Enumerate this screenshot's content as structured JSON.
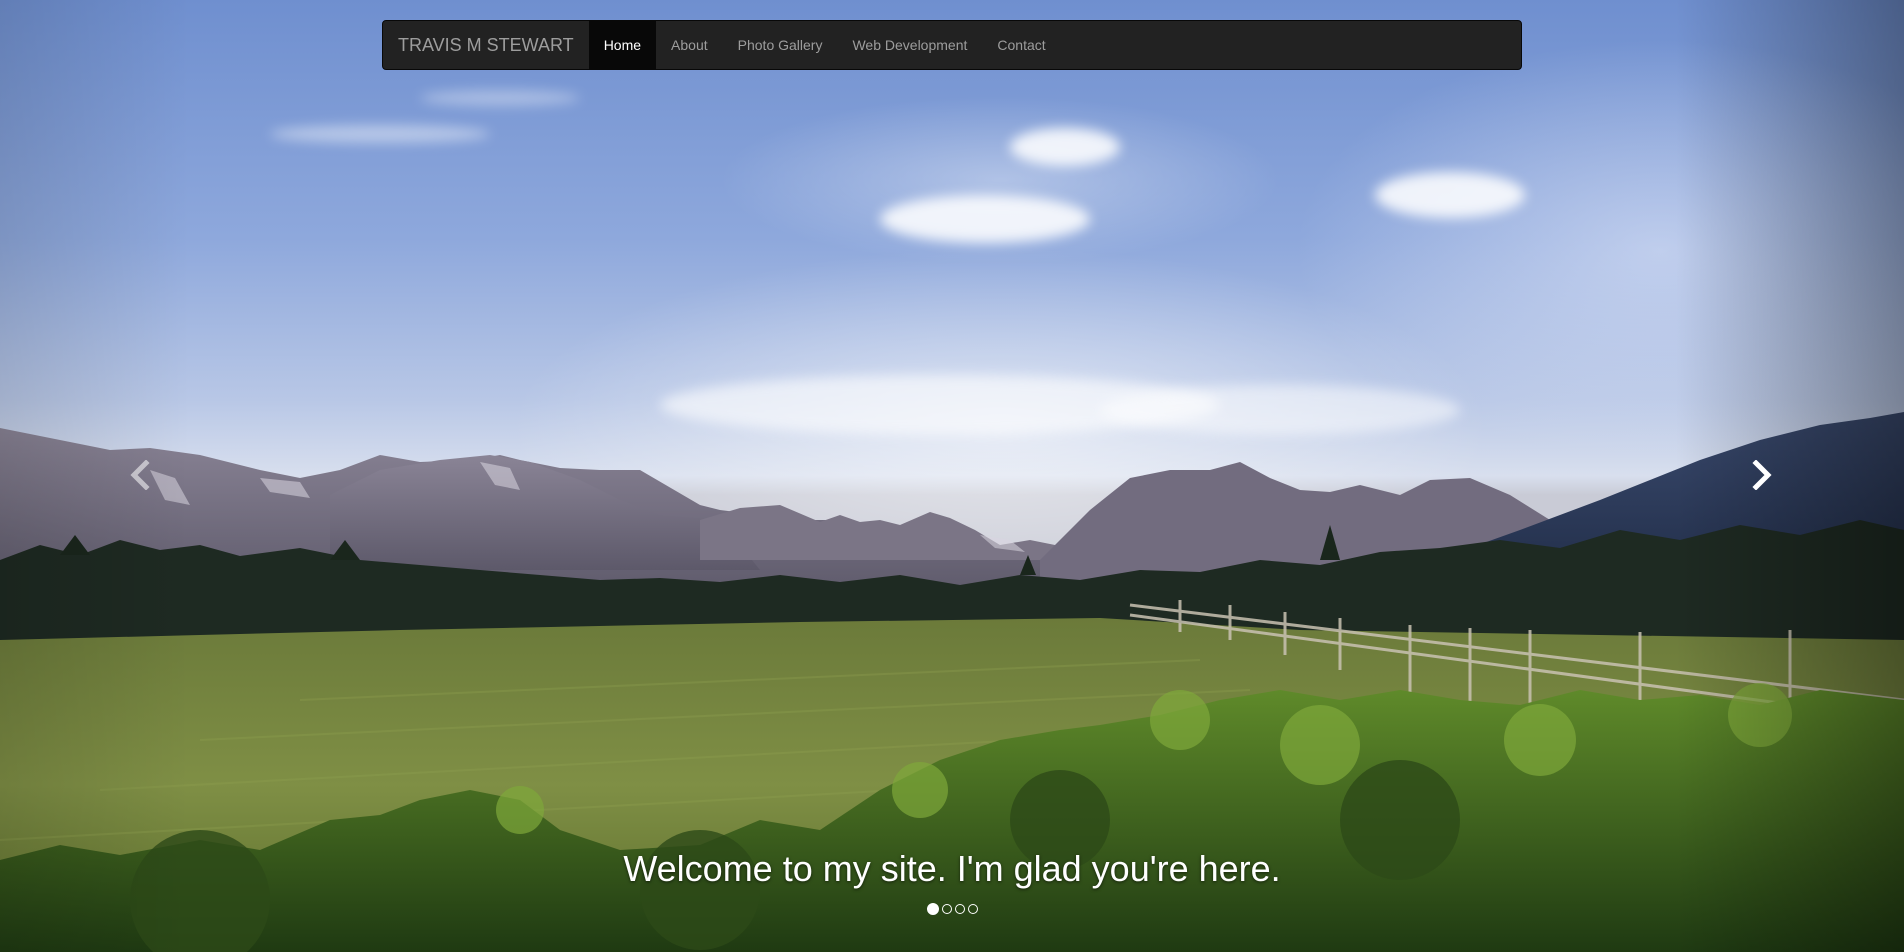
{
  "navbar": {
    "brand": "TRAVIS M STEWART",
    "items": [
      {
        "label": "Home",
        "active": true
      },
      {
        "label": "About",
        "active": false
      },
      {
        "label": "Photo Gallery",
        "active": false
      },
      {
        "label": "Web Development",
        "active": false
      },
      {
        "label": "Contact",
        "active": false
      }
    ]
  },
  "carousel": {
    "caption": "Welcome to my site. I'm glad you're here.",
    "slide_count": 4,
    "active_slide": 1,
    "prev_icon": "chevron-left-icon",
    "next_icon": "chevron-right-icon"
  },
  "colors": {
    "navbar_bg": "#222222",
    "navbar_active_bg": "#080808",
    "nav_text": "#9d9d9d",
    "nav_active_text": "#ffffff"
  }
}
